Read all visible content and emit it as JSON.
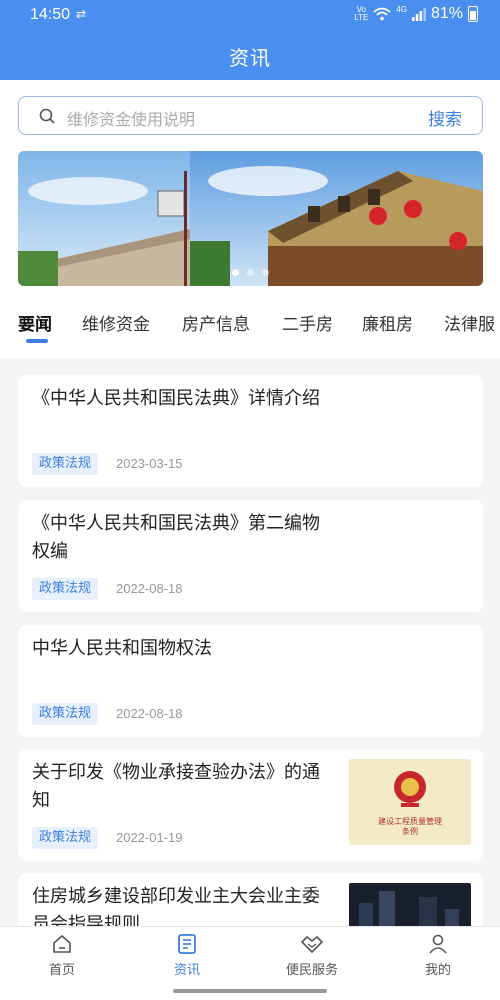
{
  "status_bar": {
    "time": "14:50",
    "network": "4G",
    "volte": "Vo LTE",
    "battery": "81%"
  },
  "header": {
    "title": "资讯"
  },
  "search": {
    "placeholder": "维修资金使用说明",
    "button_label": "搜索"
  },
  "banner": {
    "slide_count": 3,
    "active_slide": 1
  },
  "tabs": [
    {
      "label": "要闻",
      "active": true
    },
    {
      "label": "维修资金"
    },
    {
      "label": "房产信息"
    },
    {
      "label": "二手房"
    },
    {
      "label": "廉租房"
    },
    {
      "label": "法律服"
    }
  ],
  "articles": [
    {
      "title": "《中华人民共和国民法典》详情介绍",
      "tag": "政策法规",
      "date": "2023-03-15"
    },
    {
      "title": "《中华人民共和国民法典》第二编物权编",
      "tag": "政策法规",
      "date": "2022-08-18"
    },
    {
      "title": "中华人民共和国物权法",
      "tag": "政策法规",
      "date": "2022-08-18"
    },
    {
      "title": "关于印发《物业承接查验办法》的通知",
      "tag": "政策法规",
      "date": "2022-01-19",
      "thumb_text": "建设工程质量管理条例"
    },
    {
      "title": "住房城乡建设部印发业主大会业主委员会指导规则"
    }
  ],
  "bottom_nav": [
    {
      "label": "首页",
      "icon": "home-icon"
    },
    {
      "label": "资讯",
      "icon": "news-icon",
      "active": true
    },
    {
      "label": "便民服务",
      "icon": "handshake-icon"
    },
    {
      "label": "我的",
      "icon": "user-icon"
    }
  ],
  "colors": {
    "header": "#4a8ff0",
    "accent": "#3d7fe0",
    "tag_bg": "#e7f0fc",
    "page_bg": "#f4f5f7"
  }
}
